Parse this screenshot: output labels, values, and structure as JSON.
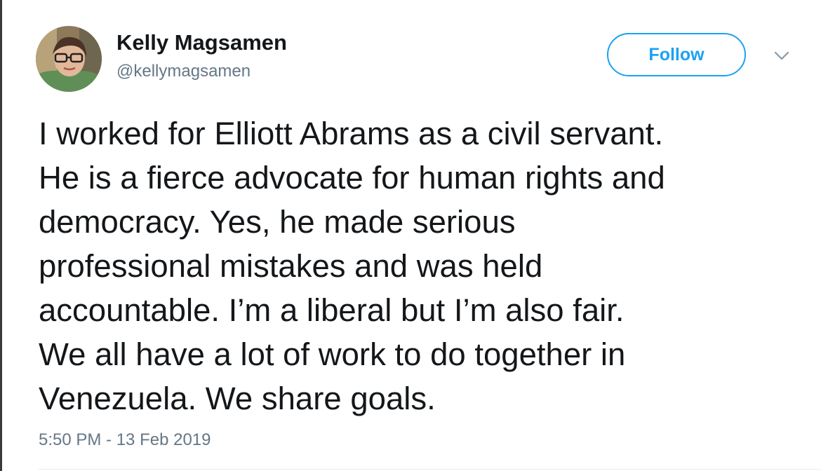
{
  "author": {
    "name": "Kelly Magsamen",
    "handle": "@kellymagsamen"
  },
  "actions": {
    "follow_label": "Follow",
    "menu_icon": "chevron-down-icon"
  },
  "tweet": {
    "lines": [
      "I worked for Elliott Abrams as a civil servant.",
      "He is a fierce advocate for human rights and",
      "democracy. Yes, he made serious",
      "professional mistakes and was held",
      "accountable. I’m a liberal but I’m also fair.",
      "We all have a lot of work to do together in",
      "Venezuela. We share goals."
    ],
    "timestamp": "5:50 PM - 13 Feb 2019"
  },
  "colors": {
    "accent": "#1da1f2",
    "text": "#14171a",
    "secondary": "#657786"
  }
}
